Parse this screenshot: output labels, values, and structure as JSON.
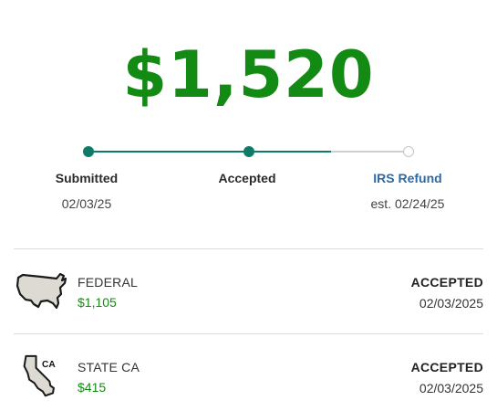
{
  "colors": {
    "accent_green": "#138a13",
    "progress_teal": "#0f7a67",
    "link_blue": "#2d6aa3"
  },
  "total_refund": "$1,520",
  "progress": {
    "completed_fraction": 0.75,
    "steps": [
      {
        "label": "Submitted",
        "date": "02/03/25",
        "state": "done"
      },
      {
        "label": "Accepted",
        "date": "",
        "state": "done"
      },
      {
        "label": "IRS Refund",
        "date": "est. 02/24/25",
        "state": "pending"
      }
    ]
  },
  "returns": [
    {
      "icon": "usa-map-icon",
      "name": "FEDERAL",
      "amount": "$1,105",
      "status": "ACCEPTED",
      "date": "02/03/2025"
    },
    {
      "icon": "california-map-icon",
      "icon_text": "CA",
      "name": "STATE CA",
      "amount": "$415",
      "status": "ACCEPTED",
      "date": "02/03/2025"
    }
  ]
}
